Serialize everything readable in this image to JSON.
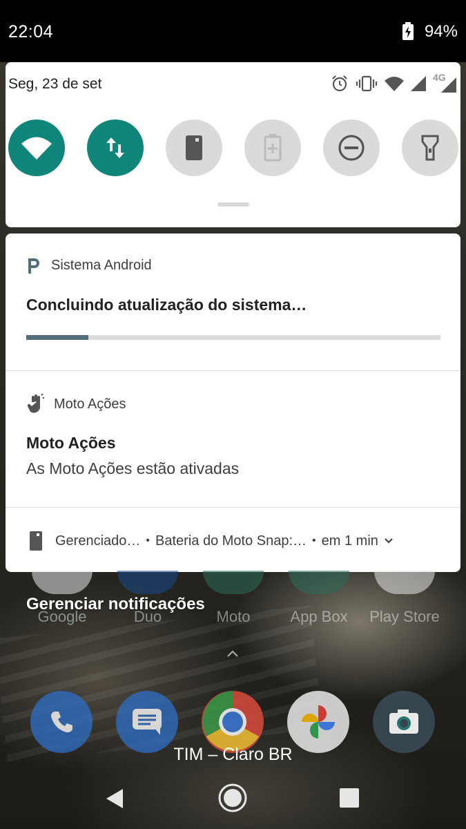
{
  "status_bar": {
    "time": "22:04",
    "battery_percent": "94%",
    "battery_state": "charging",
    "icons": [
      "battery-charging-icon"
    ]
  },
  "quick_settings": {
    "date": "Seg, 23 de set",
    "status_icons": [
      "alarm-icon",
      "vibrate-icon",
      "wifi-signal-icon",
      "cell-signal-icon",
      "cell-signal-4g-icon"
    ],
    "network_label": "4G",
    "tiles": [
      {
        "name": "wifi",
        "icon": "wifi-icon",
        "active": true
      },
      {
        "name": "mobile-data",
        "icon": "data-transfer-icon",
        "active": true
      },
      {
        "name": "auto-rotate",
        "icon": "phone-icon",
        "active": false
      },
      {
        "name": "battery-saver",
        "icon": "battery-saver-icon",
        "active": false
      },
      {
        "name": "do-not-disturb",
        "icon": "do-not-disturb-icon",
        "active": false
      },
      {
        "name": "flashlight",
        "icon": "flashlight-icon",
        "active": false
      }
    ],
    "colors": {
      "active": "#108579",
      "inactive": "#dadada"
    }
  },
  "notifications": {
    "system_update": {
      "app": "Sistema Android",
      "title": "Concluindo atualização do sistema…",
      "progress": 0.15
    },
    "moto_actions": {
      "app": "Moto Ações",
      "title": "Moto Ações",
      "text": "As Moto Ações estão ativadas"
    },
    "collapsed": {
      "app": "Gerenciado…",
      "text": "Bateria do Moto Snap:…",
      "time": "em 1 min"
    }
  },
  "manage_notifications": "Gerenciar notificações",
  "home_apps": [
    "Google",
    "Duo",
    "Moto",
    "App Box",
    "Play Store"
  ],
  "dock_icons": [
    "phone-icon",
    "messages-icon",
    "chrome-icon",
    "photos-icon",
    "camera-icon"
  ],
  "carrier": "TIM – Claro BR",
  "nav": [
    "back-icon",
    "home-icon",
    "recents-icon"
  ]
}
